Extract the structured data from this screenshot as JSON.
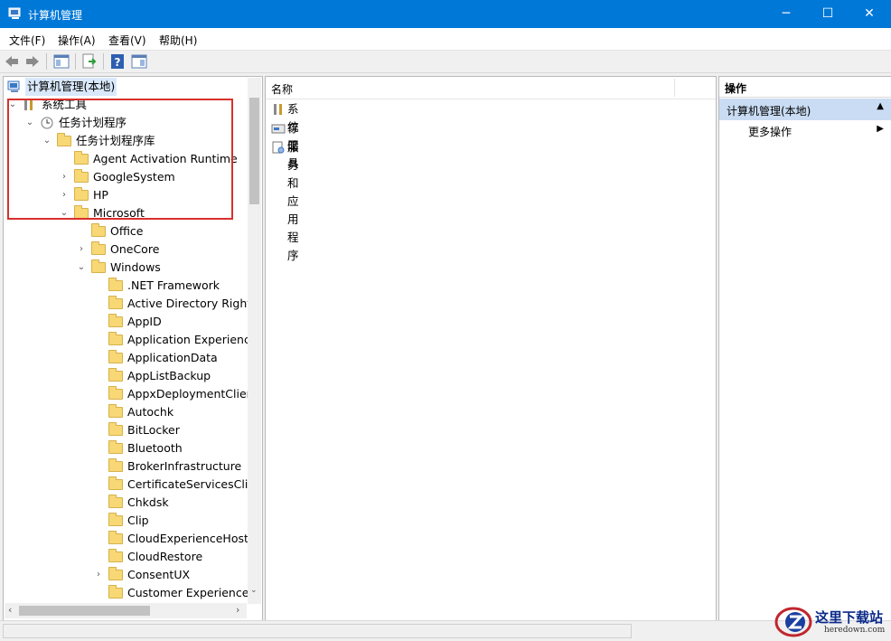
{
  "window": {
    "title": "计算机管理",
    "controls": {
      "minimize": "─",
      "maximize": "☐",
      "close": "✕"
    }
  },
  "menu": [
    {
      "label": "文件(F)"
    },
    {
      "label": "操作(A)"
    },
    {
      "label": "查看(V)"
    },
    {
      "label": "帮助(H)"
    }
  ],
  "tree": {
    "root": "计算机管理(本地)",
    "system_tools": "系统工具",
    "task_scheduler": "任务计划程序",
    "task_library": "任务计划程序库",
    "items": [
      "Agent Activation Runtime",
      "GoogleSystem",
      "HP",
      "Microsoft",
      "Office",
      "OneCore",
      "Windows",
      ".NET Framework",
      "Active Directory Rights",
      "AppID",
      "Application Experience",
      "ApplicationData",
      "AppListBackup",
      "AppxDeploymentClient",
      "Autochk",
      "BitLocker",
      "Bluetooth",
      "BrokerInfrastructure",
      "CertificateServicesClien",
      "Chkdsk",
      "Clip",
      "CloudExperienceHost",
      "CloudRestore",
      "ConsentUX",
      "Customer Experience I"
    ]
  },
  "list": {
    "column_name": "名称",
    "rows": [
      "系统工具",
      "存储",
      "服务和应用程序"
    ]
  },
  "actions": {
    "title": "操作",
    "section": "计算机管理(本地)",
    "more": "更多操作"
  },
  "watermark": {
    "text": "这里下载站",
    "sub": "heredown.com"
  },
  "colors": {
    "titlebar": "#0078d7",
    "highlight": "#d9302c",
    "action_section": "#c9dcf3",
    "folder": "#f8d775"
  }
}
